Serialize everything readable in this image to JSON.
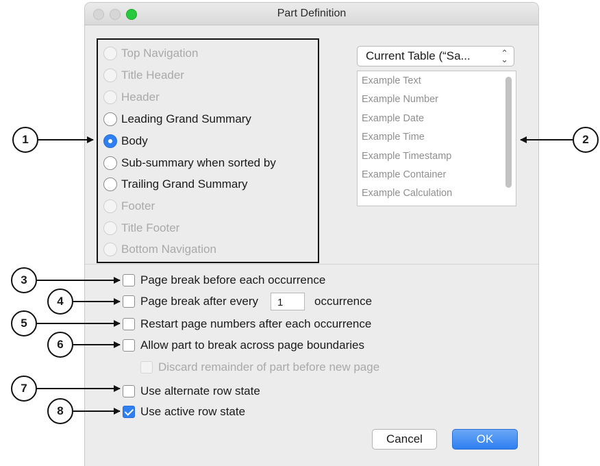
{
  "window": {
    "title": "Part Definition"
  },
  "part_types": [
    {
      "label": "Top Navigation",
      "state": "disabled"
    },
    {
      "label": "Title Header",
      "state": "disabled"
    },
    {
      "label": "Header",
      "state": "disabled"
    },
    {
      "label": "Leading Grand Summary",
      "state": "enabled"
    },
    {
      "label": "Body",
      "state": "selected"
    },
    {
      "label": "Sub-summary when sorted by",
      "state": "enabled"
    },
    {
      "label": "Trailing Grand Summary",
      "state": "enabled"
    },
    {
      "label": "Footer",
      "state": "disabled"
    },
    {
      "label": "Title Footer",
      "state": "disabled"
    },
    {
      "label": "Bottom Navigation",
      "state": "disabled"
    }
  ],
  "table_popup": {
    "value": "Current Table (“Sa..."
  },
  "field_list": [
    "Example Text",
    "Example Number",
    "Example Date",
    "Example Time",
    "Example Timestamp",
    "Example Container",
    "Example Calculation"
  ],
  "options": {
    "page_break_before": {
      "label": "Page break before each occurrence",
      "checked": false
    },
    "page_break_after": {
      "label": "Page break after every",
      "value": "1",
      "suffix": "occurrence",
      "checked": false
    },
    "restart_page_numbers": {
      "label": "Restart page numbers after each occurrence",
      "checked": false
    },
    "allow_break": {
      "label": "Allow part to break across page boundaries",
      "checked": false
    },
    "discard_remainder": {
      "label": "Discard remainder of part before new page",
      "checked": false,
      "disabled": true
    },
    "alternate_row_state": {
      "label": "Use alternate row state",
      "checked": false
    },
    "active_row_state": {
      "label": "Use active row state",
      "checked": true
    }
  },
  "buttons": {
    "cancel": "Cancel",
    "ok": "OK"
  },
  "callouts": [
    "1",
    "2",
    "3",
    "4",
    "5",
    "6",
    "7",
    "8"
  ],
  "colors": {
    "accent": "#2f7ff0",
    "disabled_text": "#a9a9a9"
  }
}
